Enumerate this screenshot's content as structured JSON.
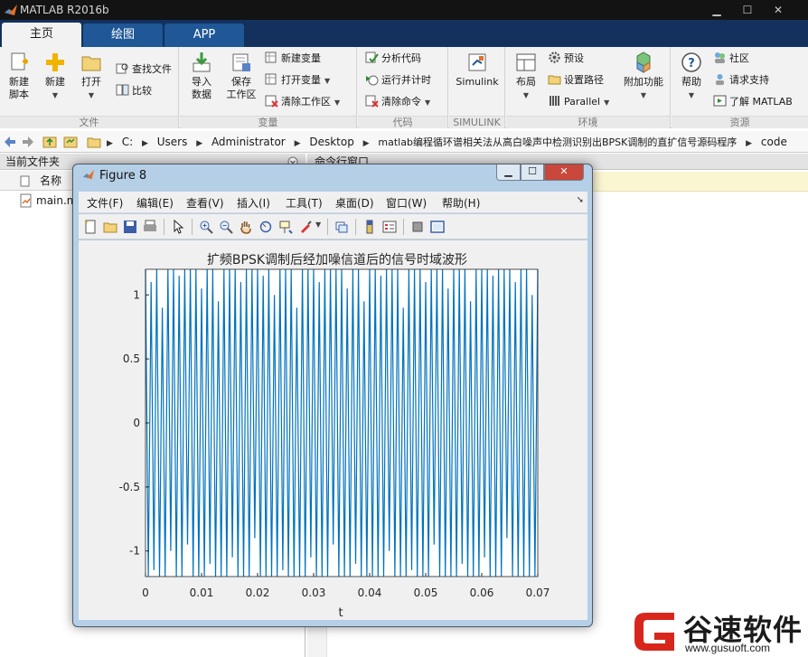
{
  "app": {
    "title": "MATLAB R2016b"
  },
  "tabs": [
    {
      "label": "主页",
      "active": true
    },
    {
      "label": "绘图",
      "active": false
    },
    {
      "label": "APP",
      "active": false
    }
  ],
  "ribbon": {
    "file": {
      "title": "文件",
      "new_script": "新建\n脚本",
      "new": "新建",
      "open": "打开",
      "find_files": "查找文件",
      "compare": "比较"
    },
    "variable": {
      "title": "变量",
      "import": "导入\n数据",
      "save_ws": "保存\n工作区",
      "new_var": "新建变量",
      "open_var": "打开变量",
      "clear_ws": "清除工作区"
    },
    "code": {
      "title": "代码",
      "analyze": "分析代码",
      "run_time": "运行并计时",
      "clear_cmd": "清除命令"
    },
    "simulink": {
      "title": "SIMULINK",
      "label": "Simulink"
    },
    "env": {
      "title": "环境",
      "layout": "布局",
      "prefs": "预设",
      "set_path": "设置路径",
      "parallel": "Parallel",
      "addons": "附加功能"
    },
    "resources": {
      "title": "资源",
      "help": "帮助",
      "community": "社区",
      "support": "请求支持",
      "learn": "了解 MATLAB"
    }
  },
  "address": {
    "crumbs": [
      "C:",
      "Users",
      "Administrator",
      "Desktop",
      "matlab编程循环谱相关法从高白噪声中检测识别出BPSK调制的直扩信号源码程序",
      "code"
    ]
  },
  "left_panel": {
    "title": "当前文件夹",
    "column": "名称",
    "file": "main.m"
  },
  "cmd_panel": {
    "title": "命令行窗口"
  },
  "figure": {
    "title": "Figure 8",
    "menus": [
      "文件(F)",
      "编辑(E)",
      "查看(V)",
      "插入(I)",
      "工具(T)",
      "桌面(D)",
      "窗口(W)",
      "帮助(H)"
    ]
  },
  "chart_data": {
    "type": "line",
    "title": "扩频BPSK调制后经加噪信道后的信号时域波形",
    "xlabel": "t",
    "ylabel": "",
    "xlim": [
      0,
      0.07
    ],
    "ylim": [
      -1.2,
      1.2
    ],
    "xticks": [
      0,
      0.01,
      0.02,
      0.03,
      0.04,
      0.05,
      0.06,
      0.07
    ],
    "xtick_labels": [
      "0",
      "0.01",
      "0.02",
      "0.03",
      "0.04",
      "0.05",
      "0.06",
      "0.07"
    ],
    "yticks": [
      -1,
      -0.5,
      0,
      0.5,
      1
    ],
    "ytick_labels": [
      "-1",
      "-0.5",
      "0",
      "0.5",
      "1"
    ],
    "series": [
      {
        "color": "#0072bd",
        "x": [
          0,
          0.0005,
          0.001,
          0.0015,
          0.002,
          0.0025,
          0.003,
          0.0035,
          0.004,
          0.0045,
          0.005,
          0.0055,
          0.006,
          0.0065,
          0.007,
          0.0075,
          0.008,
          0.0085,
          0.009,
          0.0095,
          0.01,
          0.0105,
          0.011,
          0.0115,
          0.012,
          0.0125,
          0.013,
          0.0135,
          0.014,
          0.0145,
          0.015,
          0.0155,
          0.016,
          0.0165,
          0.017,
          0.0175,
          0.018,
          0.0185,
          0.019,
          0.0195,
          0.02,
          0.0205,
          0.021,
          0.0215,
          0.022,
          0.0225,
          0.023,
          0.0235,
          0.024,
          0.0245,
          0.025,
          0.0255,
          0.026,
          0.0265,
          0.027,
          0.0275,
          0.028,
          0.0285,
          0.029,
          0.0295,
          0.03,
          0.0305,
          0.031,
          0.0315,
          0.032,
          0.0325,
          0.033,
          0.0335,
          0.034,
          0.0345,
          0.035,
          0.0355,
          0.036,
          0.0365,
          0.037,
          0.0375,
          0.038,
          0.0385,
          0.039,
          0.0395,
          0.04,
          0.0405,
          0.041,
          0.0415,
          0.042,
          0.0425,
          0.043,
          0.0435,
          0.044,
          0.0445,
          0.045,
          0.0455,
          0.046,
          0.0465,
          0.047,
          0.0475,
          0.048,
          0.0485,
          0.049,
          0.0495,
          0.05,
          0.0505,
          0.051,
          0.0515,
          0.052,
          0.0525,
          0.053,
          0.0535,
          0.054,
          0.0545,
          0.055,
          0.0555,
          0.056,
          0.0565,
          0.057,
          0.0575,
          0.058,
          0.0585,
          0.059,
          0.0595,
          0.06,
          0.0605,
          0.061,
          0.0615,
          0.062,
          0.0625,
          0.063,
          0.0635,
          0.064,
          0.0645,
          0.065,
          0.0655,
          0.066,
          0.0665,
          0.067,
          0.0675,
          0.068,
          0.0685,
          0.069,
          0.0695,
          0.07
        ],
        "y": [
          1.2,
          -1.2,
          1.1,
          -1.15,
          1.2,
          -1.2,
          0.9,
          -1.2,
          1.2,
          -1.0,
          1.2,
          -1.2,
          1.15,
          -1.2,
          1.2,
          -0.95,
          1.2,
          -1.2,
          1.2,
          -1.2,
          1.05,
          -1.2,
          1.2,
          -1.1,
          1.2,
          -1.2,
          0.95,
          -1.2,
          1.2,
          -1.2,
          1.2,
          -1.05,
          1.2,
          -1.2,
          1.1,
          -1.2,
          1.2,
          -1.2,
          1.2,
          -0.9,
          1.2,
          -1.2,
          1.15,
          -1.2,
          1.2,
          -1.2,
          1.0,
          -1.2,
          1.2,
          -1.15,
          1.2,
          -1.2,
          1.2,
          -1.2,
          0.9,
          -1.2,
          1.2,
          -1.2,
          1.2,
          -1.05,
          1.2,
          -1.2,
          1.1,
          -1.2,
          1.2,
          -1.2,
          1.2,
          -0.95,
          1.2,
          -1.2,
          1.2,
          -1.2,
          1.05,
          -1.2,
          1.2,
          -1.1,
          1.2,
          -1.2,
          0.95,
          -1.2,
          1.2,
          -1.2,
          1.2,
          -1.2,
          1.15,
          -1.2,
          1.2,
          -1.0,
          1.2,
          -1.2,
          1.2,
          -1.2,
          0.9,
          -1.2,
          1.2,
          -1.15,
          1.2,
          -1.2,
          1.2,
          -1.2,
          1.1,
          -1.2,
          1.2,
          -0.95,
          1.2,
          -1.2,
          1.2,
          -1.2,
          1.05,
          -1.2,
          1.2,
          -1.2,
          1.2,
          -1.1,
          1.2,
          -1.2,
          0.95,
          -1.2,
          1.2,
          -1.2,
          1.2,
          -1.05,
          1.2,
          -1.2,
          1.15,
          -1.2,
          1.2,
          -1.2,
          1.2,
          -0.9,
          1.2,
          -1.2,
          1.1,
          -1.2,
          1.2,
          -1.2,
          1.2,
          -1.2,
          1.0,
          -1.2,
          1.2
        ]
      }
    ]
  },
  "watermark": {
    "name": "谷速软件",
    "url": "www.gusuoft.com"
  }
}
